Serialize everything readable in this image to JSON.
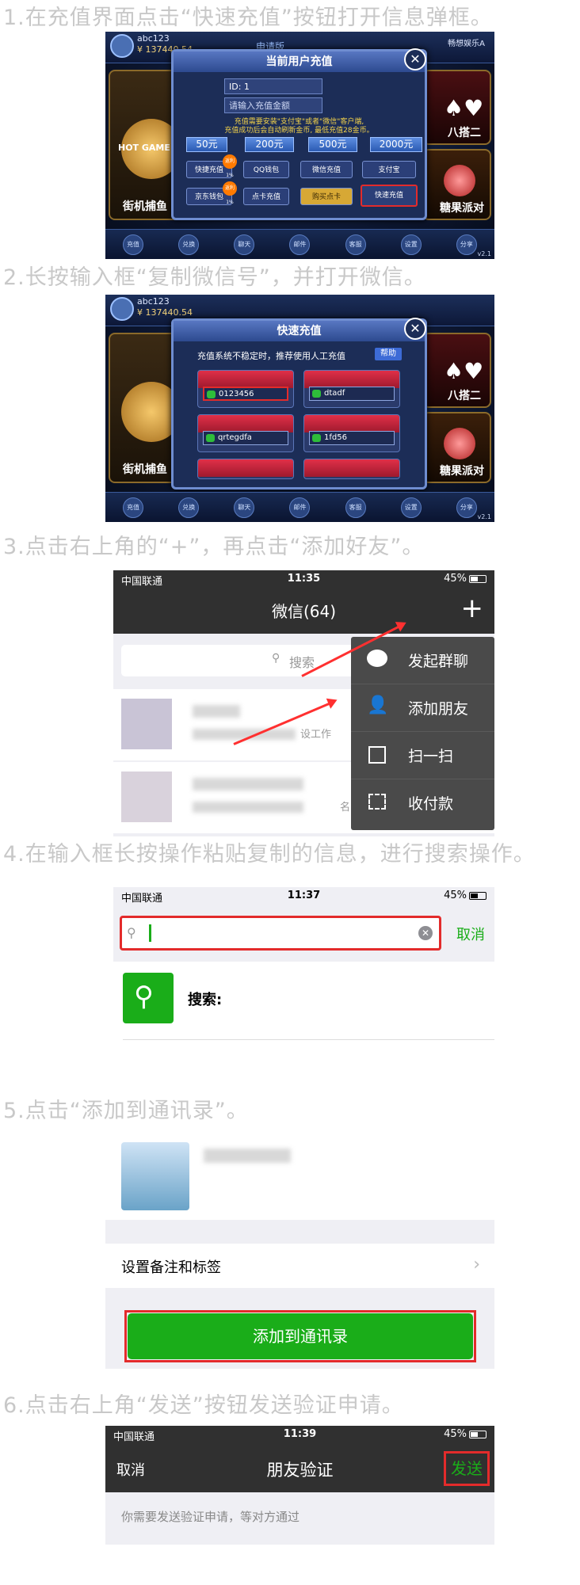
{
  "steps": [
    "1.在充值界面点击“快速充值”按钮打开信息弹框。",
    "2.长按输入框“复制微信号”，并打开微信。",
    "3.点击右上角的“+”，再点击“添加好友”。",
    "4.在输入框长按操作粘贴复制的信息，进行搜索操作。",
    "5.点击“添加到通讯录”。",
    "6.点击右上角“发送”按钮发送验证申请。"
  ],
  "game1": {
    "username": "abc123",
    "coins": "¥ 137440.54",
    "top_center": "申请版",
    "side_right": "畅想娱乐A",
    "modal_title": "当前用户充值",
    "id_field": "ID: 1",
    "amount_placeholder": "请输入充值金额",
    "notice": "充值需要安装\"支付宝\"或者\"微信\"客户端,\n充值成功后会自动刷新金币, 最低充值28金币。",
    "amounts": [
      "50元",
      "200元",
      "500元",
      "2000元"
    ],
    "pay_row1": [
      "快捷充值",
      "QQ钱包",
      "微信充值",
      "支付宝"
    ],
    "pay_row2": [
      "京东钱包",
      "点卡充值",
      "购买点卡",
      "快速充值"
    ],
    "badges": [
      "返利1%",
      "返利1%"
    ],
    "tile_left": "街机捕鱼",
    "tile_right_top": "八搭二",
    "tile_right_bottom": "糖果派对",
    "tile_logo": "HOT GAME",
    "bottom_nav": [
      "充值",
      "兑换",
      "聊天",
      "邮件",
      "客服",
      "设置",
      "分享"
    ],
    "version": "v2.1"
  },
  "game2": {
    "username": "abc123",
    "coins": "¥ 137440.54",
    "modal_title": "快速充值",
    "notice": "充值系统不稳定时，推荐使用人工充值",
    "help_label": "帮助",
    "wechat_ids": [
      "0123456",
      "dtadf",
      "qrtegdfa",
      "1fd56"
    ],
    "tile_left": "街机捕鱼",
    "tile_right_top": "八搭二",
    "tile_right_bottom": "糖果派对",
    "version": "v2.1"
  },
  "wechat_main": {
    "carrier": "中国联通",
    "time": "11:35",
    "battery": "45%",
    "title": "微信(64)",
    "plus": "+",
    "search_placeholder": "搜索",
    "menu": [
      "发起群聊",
      "添加朋友",
      "扫一扫",
      "收付款"
    ],
    "menu_icons": [
      "chat-bubble-icon",
      "add-person-icon",
      "scan-icon",
      "payment-icon"
    ],
    "chat_snippet1": "设工作",
    "chat_snippet2": "名"
  },
  "wechat_search": {
    "carrier": "中国联通",
    "time": "11:37",
    "battery": "45%",
    "cancel": "取消",
    "search_row_label": "搜索:"
  },
  "wechat_profile": {
    "remark_label": "设置备注和标签",
    "add_button": "添加到通讯录"
  },
  "wechat_verify": {
    "carrier": "中国联通",
    "time": "11:39",
    "battery": "45%",
    "cancel": "取消",
    "title": "朋友验证",
    "send": "发送",
    "hint": "你需要发送验证申请，等对方通过"
  },
  "colors": {
    "wechat_green": "#1aad19",
    "highlight_red": "#e32b2b",
    "step_text": "#c8c8c8"
  }
}
